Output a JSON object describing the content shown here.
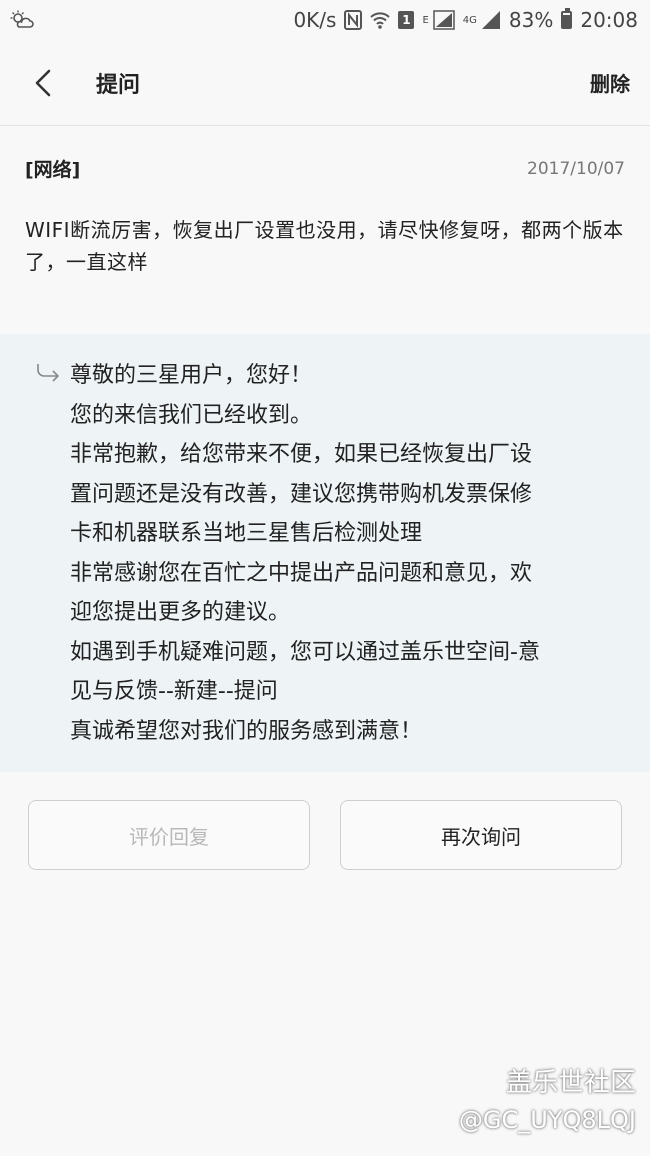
{
  "status_bar": {
    "speed": "0K/s",
    "sim": "1",
    "network_e": "E",
    "network_4g": "4G",
    "battery": "83%",
    "battery_level": 0.83,
    "time": "20:08"
  },
  "header": {
    "title": "提问",
    "delete_label": "删除"
  },
  "question": {
    "category": "[网络]",
    "date": "2017/10/07",
    "text": "WIFI断流厉害，恢复出厂设置也没用，请尽快修复呀，都两个版本了，一直这样"
  },
  "reply": {
    "lines": [
      "尊敬的三星用户，您好！",
      "您的来信我们已经收到。",
      "非常抱歉，给您带来不便，如果已经恢复出厂设",
      "置问题还是没有改善，建议您携带购机发票保修",
      "卡和机器联系当地三星售后检测处理",
      "非常感谢您在百忙之中提出产品问题和意见，欢",
      "迎您提出更多的建议。",
      "如遇到手机疑难问题，您可以通过盖乐世空间-意",
      "见与反馈--新建--提问",
      "真诚希望您对我们的服务感到满意！"
    ]
  },
  "actions": {
    "rate_label": "评价回复",
    "ask_again_label": "再次询问"
  },
  "watermark": {
    "community": "盖乐世社区",
    "user": "@GC_UYQ8LQJ"
  }
}
